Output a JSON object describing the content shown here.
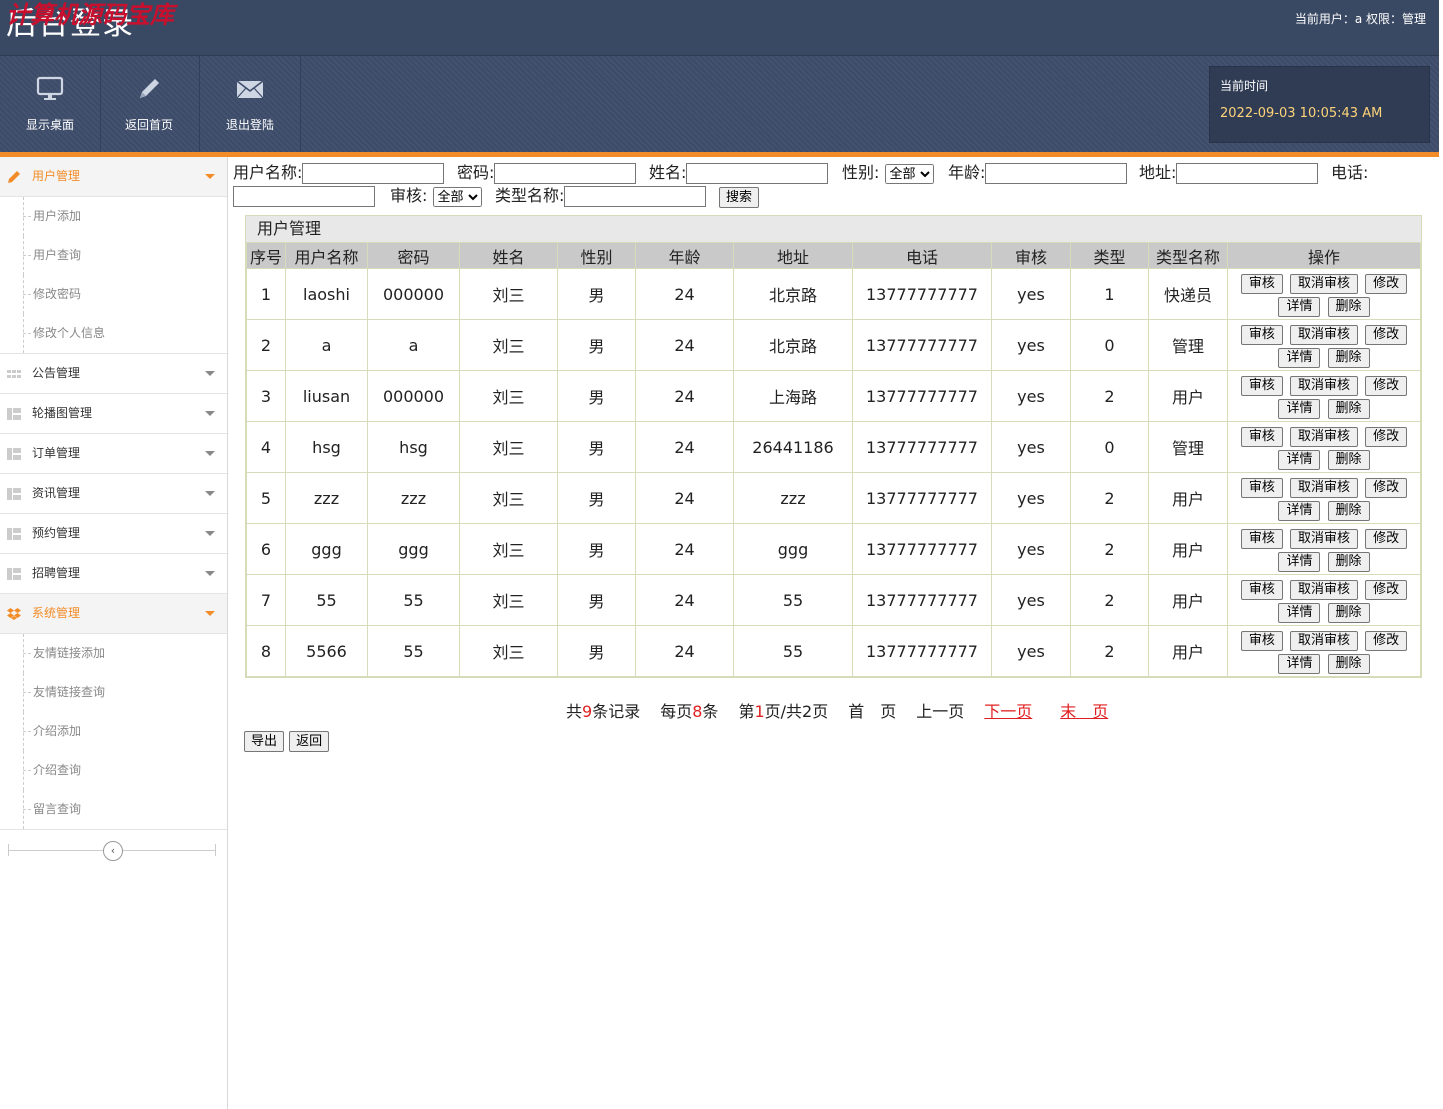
{
  "header": {
    "title": "后台登录",
    "watermark": "计算机源码宝库",
    "user_info": "当前用户：a  权限：管理",
    "nav": [
      {
        "label": "显示桌面",
        "icon": "monitor-icon"
      },
      {
        "label": "返回首页",
        "icon": "pencil-icon"
      },
      {
        "label": "退出登陆",
        "icon": "mail-icon"
      }
    ],
    "time_label": "当前时间",
    "time_value": "2022-09-03 10:05:43 AM"
  },
  "colors": {
    "accent": "#f28c28",
    "header": "#3e4d6b",
    "link": "#e02020"
  },
  "sidebar": {
    "groups": [
      {
        "label": "用户管理",
        "icon": "pencil-icon",
        "active": true,
        "items": [
          "用户添加",
          "用户查询",
          "修改密码",
          "修改个人信息"
        ]
      },
      {
        "label": "公告管理",
        "icon": "grid-icon"
      },
      {
        "label": "轮播图管理",
        "icon": "layout-icon"
      },
      {
        "label": "订单管理",
        "icon": "layout-icon"
      },
      {
        "label": "资讯管理",
        "icon": "layout-icon"
      },
      {
        "label": "预约管理",
        "icon": "layout-icon"
      },
      {
        "label": "招聘管理",
        "icon": "layout-icon"
      },
      {
        "label": "系统管理",
        "icon": "dropbox-icon",
        "active": true,
        "items": [
          "友情链接添加",
          "友情链接查询",
          "介绍添加",
          "介绍查询",
          "留言查询"
        ]
      }
    ],
    "collapse_glyph": "‹"
  },
  "search": {
    "username_label": "用户名称:",
    "password_label": "密码:",
    "name_label": "姓名:",
    "gender_label": "性别:",
    "gender_value": "全部",
    "age_label": "年龄:",
    "address_label": "地址:",
    "phone_label": "电话:",
    "audit_label": "审核:",
    "audit_value": "全部",
    "typename_label": "类型名称:",
    "search_button": "搜索"
  },
  "table": {
    "title": "用户管理",
    "columns": [
      "序号",
      "用户名称",
      "密码",
      "姓名",
      "性别",
      "年龄",
      "地址",
      "电话",
      "审核",
      "类型",
      "类型名称",
      "操作"
    ],
    "rows": [
      [
        "1",
        "laoshi",
        "000000",
        "刘三",
        "男",
        "24",
        "北京路",
        "13777777777",
        "yes",
        "1",
        "快递员"
      ],
      [
        "2",
        "a",
        "a",
        "刘三",
        "男",
        "24",
        "北京路",
        "13777777777",
        "yes",
        "0",
        "管理"
      ],
      [
        "3",
        "liusan",
        "000000",
        "刘三",
        "男",
        "24",
        "上海路",
        "13777777777",
        "yes",
        "2",
        "用户"
      ],
      [
        "4",
        "hsg",
        "hsg",
        "刘三",
        "男",
        "24",
        "26441186",
        "13777777777",
        "yes",
        "0",
        "管理"
      ],
      [
        "5",
        "zzz",
        "zzz",
        "刘三",
        "男",
        "24",
        "zzz",
        "13777777777",
        "yes",
        "2",
        "用户"
      ],
      [
        "6",
        "ggg",
        "ggg",
        "刘三",
        "男",
        "24",
        "ggg",
        "13777777777",
        "yes",
        "2",
        "用户"
      ],
      [
        "7",
        "55",
        "55",
        "刘三",
        "男",
        "24",
        "55",
        "13777777777",
        "yes",
        "2",
        "用户"
      ],
      [
        "8",
        "5566",
        "55",
        "刘三",
        "男",
        "24",
        "55",
        "13777777777",
        "yes",
        "2",
        "用户"
      ]
    ],
    "actions": [
      "审核",
      "取消审核",
      "修改",
      "详情",
      "删除"
    ]
  },
  "pager": {
    "total_prefix": "共",
    "total": "9",
    "total_suffix": "条记录",
    "per_prefix": "每页",
    "per": "8",
    "per_suffix": "条",
    "page_prefix": "第",
    "page": "1",
    "page_suffix": "页/共2页",
    "first": "首　页",
    "prev": "上一页",
    "next": "下一页",
    "last": "末　页"
  },
  "bottom": {
    "export": "导出",
    "back": "返回"
  }
}
